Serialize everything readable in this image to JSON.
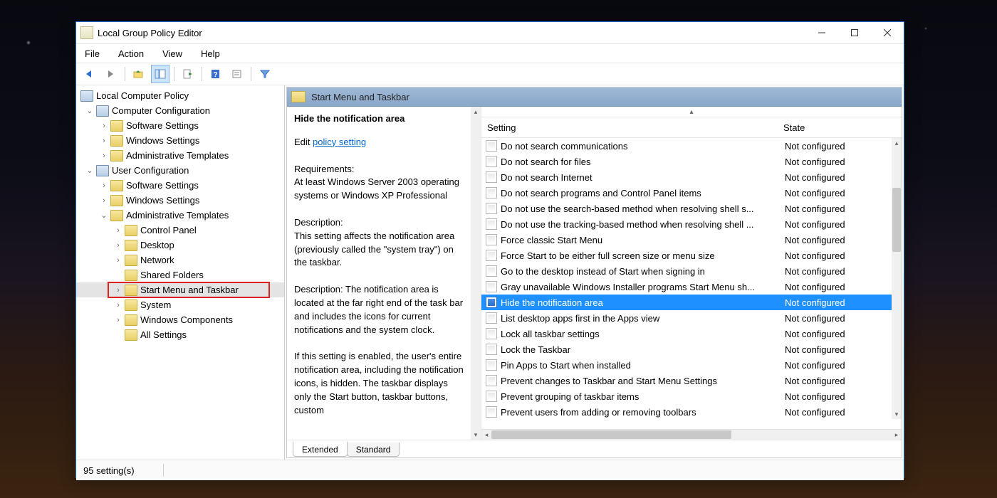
{
  "window": {
    "title": "Local Group Policy Editor",
    "menu": [
      "File",
      "Action",
      "View",
      "Help"
    ]
  },
  "tree": {
    "root": "Local Computer Policy",
    "computer_cfg": "Computer Configuration",
    "cc_children": [
      "Software Settings",
      "Windows Settings",
      "Administrative Templates"
    ],
    "user_cfg": "User Configuration",
    "uc_children": [
      "Software Settings",
      "Windows Settings"
    ],
    "admin_tmpl": "Administrative Templates",
    "at_children": [
      "Control Panel",
      "Desktop",
      "Network",
      "Shared Folders",
      "Start Menu and Taskbar",
      "System",
      "Windows Components",
      "All Settings"
    ]
  },
  "crumb": "Start Menu and Taskbar",
  "detail": {
    "heading": "Hide the notification area",
    "edit_pre": "Edit ",
    "edit_link": "policy setting",
    "req_h": "Requirements:",
    "req": "At least Windows Server 2003 operating systems or Windows XP Professional",
    "desc_h": "Description:",
    "desc1": "This setting affects the notification area (previously called the \"system tray\") on the taskbar.",
    "desc2": "Description: The notification area is located at the far right end of the task bar and includes the icons for current notifications and the system clock.",
    "desc3": "If this setting is enabled, the user's entire notification area, including the notification icons, is hidden. The taskbar displays only the Start button, taskbar buttons, custom"
  },
  "columns": {
    "setting": "Setting",
    "state": "State"
  },
  "settings": [
    {
      "name": "Do not search communications",
      "state": "Not configured",
      "sel": false
    },
    {
      "name": "Do not search for files",
      "state": "Not configured",
      "sel": false
    },
    {
      "name": "Do not search Internet",
      "state": "Not configured",
      "sel": false
    },
    {
      "name": "Do not search programs and Control Panel items",
      "state": "Not configured",
      "sel": false
    },
    {
      "name": "Do not use the search-based method when resolving shell s...",
      "state": "Not configured",
      "sel": false
    },
    {
      "name": "Do not use the tracking-based method when resolving shell ...",
      "state": "Not configured",
      "sel": false
    },
    {
      "name": "Force classic Start Menu",
      "state": "Not configured",
      "sel": false
    },
    {
      "name": "Force Start to be either full screen size or menu size",
      "state": "Not configured",
      "sel": false
    },
    {
      "name": "Go to the desktop instead of Start when signing in",
      "state": "Not configured",
      "sel": false
    },
    {
      "name": "Gray unavailable Windows Installer programs Start Menu sh...",
      "state": "Not configured",
      "sel": false
    },
    {
      "name": "Hide the notification area",
      "state": "Not configured",
      "sel": true
    },
    {
      "name": "List desktop apps first in the Apps view",
      "state": "Not configured",
      "sel": false
    },
    {
      "name": "Lock all taskbar settings",
      "state": "Not configured",
      "sel": false
    },
    {
      "name": "Lock the Taskbar",
      "state": "Not configured",
      "sel": false
    },
    {
      "name": "Pin Apps to Start when installed",
      "state": "Not configured",
      "sel": false
    },
    {
      "name": "Prevent changes to Taskbar and Start Menu Settings",
      "state": "Not configured",
      "sel": false
    },
    {
      "name": "Prevent grouping of taskbar items",
      "state": "Not configured",
      "sel": false
    },
    {
      "name": "Prevent users from adding or removing toolbars",
      "state": "Not configured",
      "sel": false
    }
  ],
  "tabs": {
    "extended": "Extended",
    "standard": "Standard"
  },
  "status": "95 setting(s)"
}
